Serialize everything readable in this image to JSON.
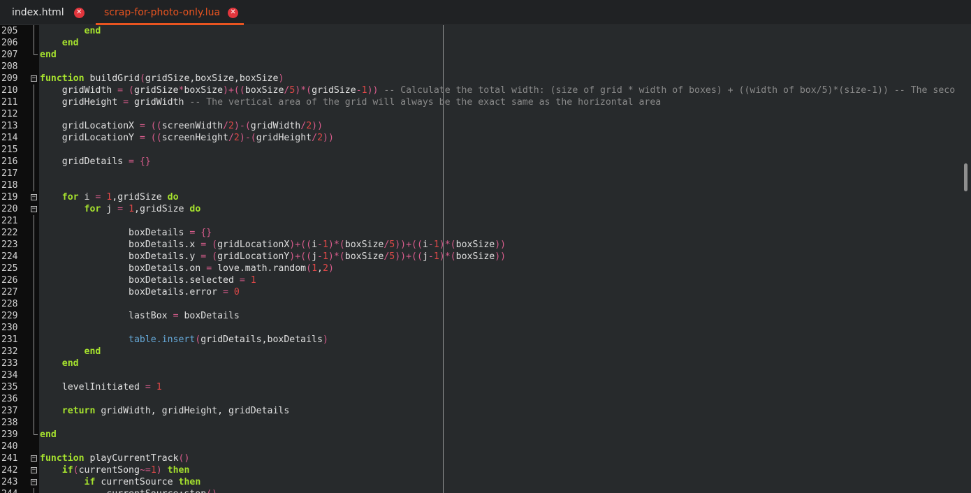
{
  "tabs": [
    {
      "label": "index.html",
      "close": "✕",
      "active": false
    },
    {
      "label": "scrap-for-photo-only.lua",
      "close": "✕",
      "active": true
    }
  ],
  "colors": {
    "accent": "#e95420",
    "close_button": "#e2363d",
    "keyword": "#a6e22e",
    "number": "#e04848",
    "operator": "#d85c8c",
    "comment": "#8a8a8a",
    "builtin": "#66a9d9"
  },
  "editor": {
    "lines": [
      {
        "n": "205",
        "guide": "line",
        "code": [
          [
            "kw",
            "        end"
          ]
        ]
      },
      {
        "n": "206",
        "guide": "line",
        "code": [
          [
            "kw",
            "    end"
          ]
        ]
      },
      {
        "n": "207",
        "guide": "end",
        "code": [
          [
            "kw",
            "end"
          ]
        ]
      },
      {
        "n": "208",
        "code": []
      },
      {
        "n": "209",
        "fold": "−",
        "code": [
          [
            "kw",
            "function"
          ],
          [
            "id",
            " buildGrid"
          ],
          [
            "op",
            "("
          ],
          [
            "id",
            "gridSize,boxSize,boxSize"
          ],
          [
            "op",
            ")"
          ]
        ]
      },
      {
        "n": "210",
        "guide": "line",
        "code": [
          [
            "id",
            "    gridWidth "
          ],
          [
            "op",
            "= ("
          ],
          [
            "id",
            "gridSize"
          ],
          [
            "op",
            "*"
          ],
          [
            "id",
            "boxSize"
          ],
          [
            "op",
            ")+(("
          ],
          [
            "id",
            "boxSize"
          ],
          [
            "op",
            "/"
          ],
          [
            "num",
            "5"
          ],
          [
            "op",
            ")*("
          ],
          [
            "id",
            "gridSize"
          ],
          [
            "op",
            "-"
          ],
          [
            "num",
            "1"
          ],
          [
            "op",
            "))"
          ],
          [
            "cm",
            " -- Calculate the total width: (size of grid * width of boxes) + ((width of box/5)*(size-1)) -- The seco"
          ]
        ]
      },
      {
        "n": "211",
        "guide": "line",
        "code": [
          [
            "id",
            "    gridHeight "
          ],
          [
            "op",
            "="
          ],
          [
            "id",
            " gridWidth "
          ],
          [
            "cm",
            "-- The vertical area of the grid will always be the exact same as the horizontal area"
          ]
        ]
      },
      {
        "n": "212",
        "guide": "line",
        "code": []
      },
      {
        "n": "213",
        "guide": "line",
        "code": [
          [
            "id",
            "    gridLocationX "
          ],
          [
            "op",
            "= (("
          ],
          [
            "id",
            "screenWidth"
          ],
          [
            "op",
            "/"
          ],
          [
            "num",
            "2"
          ],
          [
            "op",
            ")-("
          ],
          [
            "id",
            "gridWidth"
          ],
          [
            "op",
            "/"
          ],
          [
            "num",
            "2"
          ],
          [
            "op",
            "))"
          ]
        ]
      },
      {
        "n": "214",
        "guide": "line",
        "code": [
          [
            "id",
            "    gridLocationY "
          ],
          [
            "op",
            "= (("
          ],
          [
            "id",
            "screenHeight"
          ],
          [
            "op",
            "/"
          ],
          [
            "num",
            "2"
          ],
          [
            "op",
            ")-("
          ],
          [
            "id",
            "gridHeight"
          ],
          [
            "op",
            "/"
          ],
          [
            "num",
            "2"
          ],
          [
            "op",
            "))"
          ]
        ]
      },
      {
        "n": "215",
        "guide": "line",
        "code": []
      },
      {
        "n": "216",
        "guide": "line",
        "code": [
          [
            "id",
            "    gridDetails "
          ],
          [
            "op",
            "= {}"
          ]
        ]
      },
      {
        "n": "217",
        "guide": "line",
        "code": []
      },
      {
        "n": "218",
        "guide": "line",
        "code": []
      },
      {
        "n": "219",
        "fold": "−",
        "code": [
          [
            "kw",
            "    for"
          ],
          [
            "id",
            " i "
          ],
          [
            "op",
            "="
          ],
          [
            "num",
            " 1"
          ],
          [
            "id",
            ",gridSize "
          ],
          [
            "kw",
            "do"
          ]
        ]
      },
      {
        "n": "220",
        "fold": "−",
        "code": [
          [
            "kw",
            "        for"
          ],
          [
            "id",
            " j "
          ],
          [
            "op",
            "="
          ],
          [
            "num",
            " 1"
          ],
          [
            "id",
            ",gridSize "
          ],
          [
            "kw",
            "do"
          ]
        ]
      },
      {
        "n": "221",
        "guide": "line",
        "code": []
      },
      {
        "n": "222",
        "guide": "line",
        "code": [
          [
            "id",
            "                boxDetails "
          ],
          [
            "op",
            "= {}"
          ]
        ]
      },
      {
        "n": "223",
        "guide": "line",
        "code": [
          [
            "id",
            "                boxDetails.x "
          ],
          [
            "op",
            "= ("
          ],
          [
            "id",
            "gridLocationX"
          ],
          [
            "op",
            ")+(("
          ],
          [
            "id",
            "i"
          ],
          [
            "op",
            "-"
          ],
          [
            "num",
            "1"
          ],
          [
            "op",
            ")*("
          ],
          [
            "id",
            "boxSize"
          ],
          [
            "op",
            "/"
          ],
          [
            "num",
            "5"
          ],
          [
            "op",
            "))+(("
          ],
          [
            "id",
            "i"
          ],
          [
            "op",
            "-"
          ],
          [
            "num",
            "1"
          ],
          [
            "op",
            ")*("
          ],
          [
            "id",
            "boxSize"
          ],
          [
            "op",
            "))"
          ]
        ]
      },
      {
        "n": "224",
        "guide": "line",
        "code": [
          [
            "id",
            "                boxDetails.y "
          ],
          [
            "op",
            "= ("
          ],
          [
            "id",
            "gridLocationY"
          ],
          [
            "op",
            ")+(("
          ],
          [
            "id",
            "j"
          ],
          [
            "op",
            "-"
          ],
          [
            "num",
            "1"
          ],
          [
            "op",
            ")*("
          ],
          [
            "id",
            "boxSize"
          ],
          [
            "op",
            "/"
          ],
          [
            "num",
            "5"
          ],
          [
            "op",
            "))+(("
          ],
          [
            "id",
            "j"
          ],
          [
            "op",
            "-"
          ],
          [
            "num",
            "1"
          ],
          [
            "op",
            ")*("
          ],
          [
            "id",
            "boxSize"
          ],
          [
            "op",
            "))"
          ]
        ]
      },
      {
        "n": "225",
        "guide": "line",
        "code": [
          [
            "id",
            "                boxDetails.on "
          ],
          [
            "op",
            "="
          ],
          [
            "id",
            " love.math.random"
          ],
          [
            "op",
            "("
          ],
          [
            "num",
            "1"
          ],
          [
            "id",
            ","
          ],
          [
            "num",
            "2"
          ],
          [
            "op",
            ")"
          ]
        ]
      },
      {
        "n": "226",
        "guide": "line",
        "code": [
          [
            "id",
            "                boxDetails.selected "
          ],
          [
            "op",
            "="
          ],
          [
            "num",
            " 1"
          ]
        ]
      },
      {
        "n": "227",
        "guide": "line",
        "code": [
          [
            "id",
            "                boxDetails.error "
          ],
          [
            "op",
            "="
          ],
          [
            "num",
            " 0"
          ]
        ]
      },
      {
        "n": "228",
        "guide": "line",
        "code": []
      },
      {
        "n": "229",
        "guide": "line",
        "code": [
          [
            "id",
            "                lastBox "
          ],
          [
            "op",
            "="
          ],
          [
            "id",
            " boxDetails"
          ]
        ]
      },
      {
        "n": "230",
        "guide": "line",
        "code": []
      },
      {
        "n": "231",
        "guide": "line",
        "code": [
          [
            "fn",
            "                table.insert"
          ],
          [
            "op",
            "("
          ],
          [
            "id",
            "gridDetails,boxDetails"
          ],
          [
            "op",
            ")"
          ]
        ]
      },
      {
        "n": "232",
        "guide": "line",
        "code": [
          [
            "kw",
            "        end"
          ]
        ]
      },
      {
        "n": "233",
        "guide": "line",
        "code": [
          [
            "kw",
            "    end"
          ]
        ]
      },
      {
        "n": "234",
        "guide": "line",
        "code": []
      },
      {
        "n": "235",
        "guide": "line",
        "code": [
          [
            "id",
            "    levelInitiated "
          ],
          [
            "op",
            "="
          ],
          [
            "num",
            " 1"
          ]
        ]
      },
      {
        "n": "236",
        "guide": "line",
        "code": []
      },
      {
        "n": "237",
        "guide": "line",
        "code": [
          [
            "kw",
            "    return"
          ],
          [
            "id",
            " gridWidth, gridHeight, gridDetails"
          ]
        ]
      },
      {
        "n": "238",
        "guide": "line",
        "code": []
      },
      {
        "n": "239",
        "guide": "end",
        "code": [
          [
            "kw",
            "end"
          ]
        ]
      },
      {
        "n": "240",
        "code": []
      },
      {
        "n": "241",
        "fold": "−",
        "code": [
          [
            "kw",
            "function"
          ],
          [
            "id",
            " playCurrentTrack"
          ],
          [
            "op",
            "()"
          ]
        ]
      },
      {
        "n": "242",
        "fold": "−",
        "code": [
          [
            "kw",
            "    if"
          ],
          [
            "op",
            "("
          ],
          [
            "id",
            "currentSong"
          ],
          [
            "op",
            "~="
          ],
          [
            "num",
            "1"
          ],
          [
            "op",
            ")"
          ],
          [
            "kw",
            " then"
          ]
        ]
      },
      {
        "n": "243",
        "fold": "−",
        "code": [
          [
            "kw",
            "        if"
          ],
          [
            "id",
            " currentSource "
          ],
          [
            "kw",
            "then"
          ]
        ]
      },
      {
        "n": "244",
        "guide": "line",
        "code": [
          [
            "id",
            "            currentSource:stop"
          ],
          [
            "op",
            "()"
          ]
        ]
      }
    ]
  }
}
